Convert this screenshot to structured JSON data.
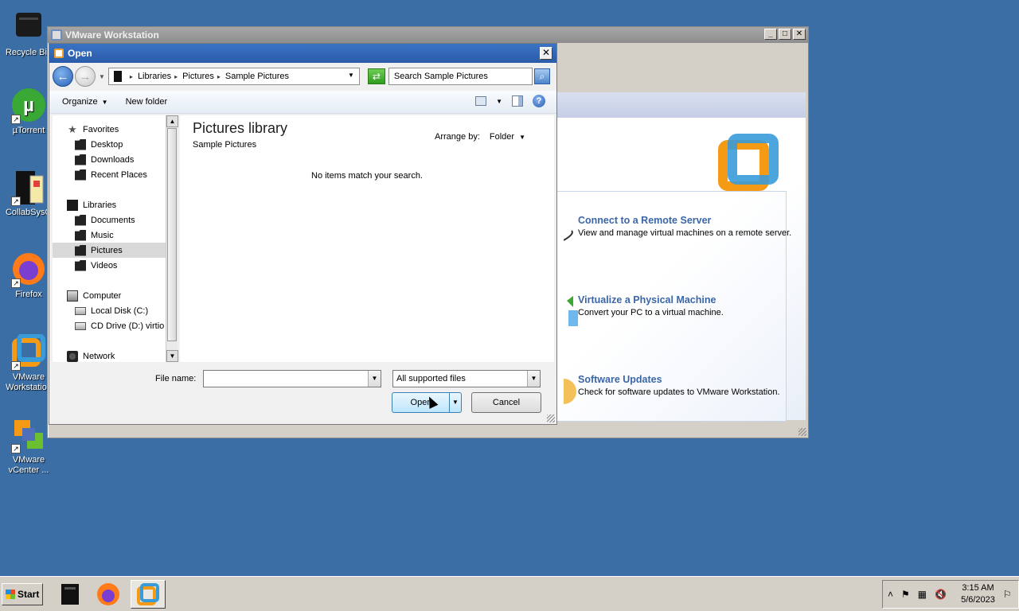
{
  "desktop": {
    "icons": [
      {
        "label": "Recycle Bin",
        "name": "recycle-bin"
      },
      {
        "label": "µTorrent",
        "name": "utorrent"
      },
      {
        "label": "CollabSysO",
        "name": "collabsys"
      },
      {
        "label": "Firefox",
        "name": "firefox"
      },
      {
        "label": "VMware Workstation",
        "name": "vmware-workstation"
      },
      {
        "label": "VMware vCenter ...",
        "name": "vmware-vcenter"
      }
    ]
  },
  "vmware_window": {
    "title": "VMware Workstation",
    "actions": [
      {
        "title": "Connect to a Remote Server",
        "desc": "View and manage virtual machines on a remote server."
      },
      {
        "title": "Virtualize a Physical Machine",
        "desc": "Convert your PC to a virtual machine."
      },
      {
        "title": "Software Updates",
        "desc": "Check for software updates to VMware Workstation."
      }
    ]
  },
  "dialog": {
    "title": "Open",
    "close_glyph": "✕",
    "breadcrumb": [
      "Libraries",
      "Pictures",
      "Sample Pictures"
    ],
    "search_placeholder": "Search Sample Pictures",
    "toolbar": {
      "organize": "Organize",
      "new_folder": "New folder",
      "help": "?"
    },
    "nav": {
      "favorites": "Favorites",
      "desktop": "Desktop",
      "downloads": "Downloads",
      "recent": "Recent Places",
      "libraries": "Libraries",
      "documents": "Documents",
      "music": "Music",
      "pictures": "Pictures",
      "videos": "Videos",
      "computer": "Computer",
      "local_disk": "Local Disk (C:)",
      "cd_drive": "CD Drive (D:) virtio",
      "network": "Network"
    },
    "content": {
      "title": "Pictures library",
      "subtitle": "Sample Pictures",
      "arrange_label": "Arrange by:",
      "arrange_value": "Folder",
      "empty_message": "No items match your search."
    },
    "file_name_label": "File name:",
    "file_name_value": "",
    "file_type": "All supported files",
    "open_label": "Open",
    "cancel_label": "Cancel"
  },
  "taskbar": {
    "start_label": "Start",
    "clock_time": "3:15 AM",
    "clock_date": "5/6/2023"
  },
  "colors": {
    "desktop": "#3a6ea5",
    "link_blue": "#3a66a8",
    "vmware_orange": "#f59a14",
    "vmware_blue": "#3a9bd9"
  }
}
